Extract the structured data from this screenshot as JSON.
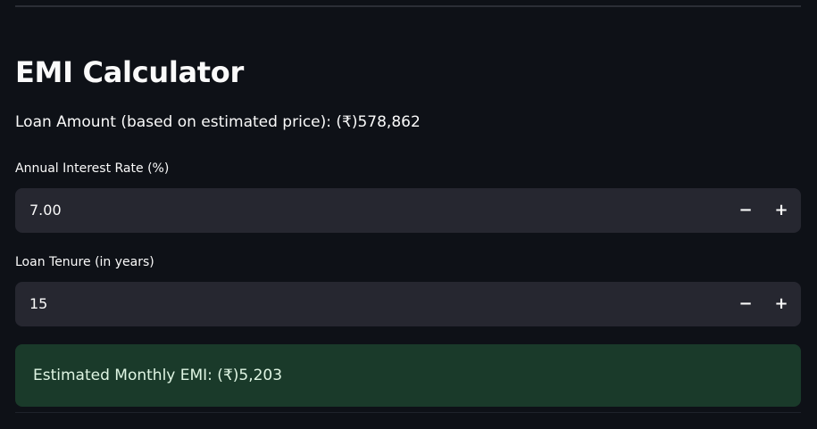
{
  "page": {
    "title": "EMI Calculator",
    "loan_amount_text": "Loan Amount (based on estimated price): (₹)578,862"
  },
  "interest_rate": {
    "label": "Annual Interest Rate (%)",
    "value": "7.00",
    "decrement_label": "−",
    "increment_label": "+"
  },
  "loan_tenure": {
    "label": "Loan Tenure (in years)",
    "value": "15",
    "decrement_label": "−",
    "increment_label": "+"
  },
  "result": {
    "text": "Estimated Monthly EMI: (₹)5,203"
  },
  "colors": {
    "background": "#0e1117",
    "input_background": "#262730",
    "success_background": "#1a3a2a",
    "success_text": "#dff5e3"
  }
}
